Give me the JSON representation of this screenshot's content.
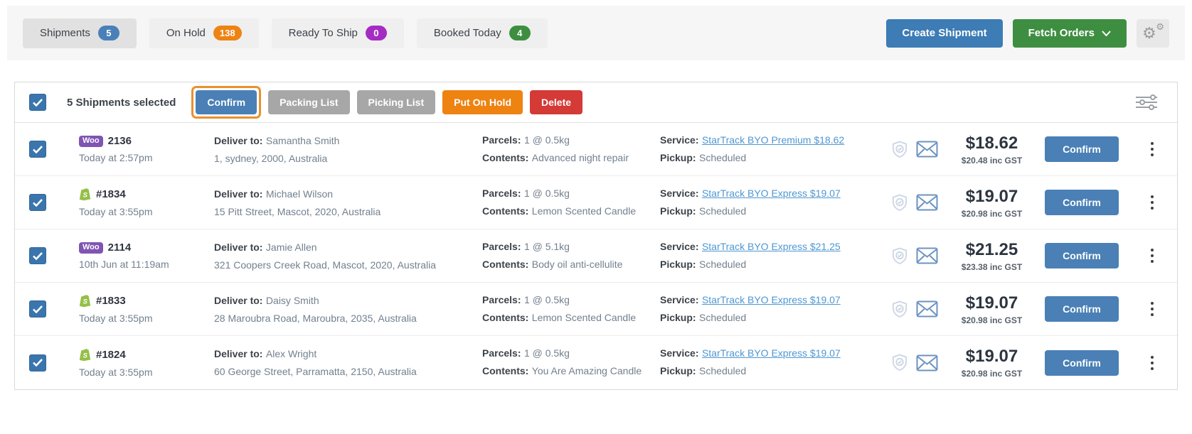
{
  "top_bar": {
    "tabs": [
      {
        "label": "Shipments",
        "count": "5",
        "badge_color": "#4a80b8",
        "active": true
      },
      {
        "label": "On Hold",
        "count": "138",
        "badge_color": "#ee8312",
        "active": false
      },
      {
        "label": "Ready To Ship",
        "count": "0",
        "badge_color": "#a42cc3",
        "active": false
      },
      {
        "label": "Booked Today",
        "count": "4",
        "badge_color": "#3e8e41",
        "active": false
      }
    ],
    "create_shipment_label": "Create Shipment",
    "fetch_orders_label": "Fetch Orders"
  },
  "bulk_bar": {
    "selected_text": "5 Shipments selected",
    "confirm_label": "Confirm",
    "packing_list_label": "Packing List",
    "picking_list_label": "Picking List",
    "put_on_hold_label": "Put On Hold",
    "delete_label": "Delete"
  },
  "labels": {
    "deliver_to": "Deliver to:",
    "parcels": "Parcels:",
    "contents": "Contents:",
    "service": "Service:",
    "pickup": "Pickup:",
    "row_confirm": "Confirm",
    "woo_badge_text": "Woo",
    "shopify_letter": "S"
  },
  "colors": {
    "primary_blue": "#3d7cb5",
    "confirm_blue": "#4a80b5",
    "green": "#3e8e41",
    "orange": "#ee8312",
    "red": "#d43a36",
    "gray_button": "#a7a7a7",
    "purple_badge": "#a42cc3",
    "link_blue": "#4e97d1",
    "highlight_orange": "#e8912d",
    "woo_purple": "#7f54b3",
    "shopify_green": "#95bf47"
  },
  "rows": [
    {
      "source": "woocommerce",
      "order_id": "2136",
      "date": "Today at 2:57pm",
      "recipient": "Samantha Smith",
      "address": "1, sydney, 2000, Australia",
      "parcels": "1 @ 0.5kg",
      "contents": "Advanced night repair",
      "service": "StarTrack BYO Premium $18.62",
      "pickup": "Scheduled",
      "price": "$18.62",
      "price_inc_gst": "$20.48 inc GST"
    },
    {
      "source": "shopify",
      "order_id": "#1834",
      "date": "Today at 3:55pm",
      "recipient": "Michael Wilson",
      "address": "15 Pitt Street, Mascot, 2020, Australia",
      "parcels": "1 @ 0.5kg",
      "contents": "Lemon Scented Candle",
      "service": "StarTrack BYO Express $19.07",
      "pickup": "Scheduled",
      "price": "$19.07",
      "price_inc_gst": "$20.98 inc GST"
    },
    {
      "source": "woocommerce",
      "order_id": "2114",
      "date": "10th Jun at 11:19am",
      "recipient": "Jamie Allen",
      "address": "321 Coopers Creek Road, Mascot, 2020, Australia",
      "parcels": "1 @ 5.1kg",
      "contents": "Body oil anti-cellulite",
      "service": "StarTrack BYO Express $21.25",
      "pickup": "Scheduled",
      "price": "$21.25",
      "price_inc_gst": "$23.38 inc GST"
    },
    {
      "source": "shopify",
      "order_id": "#1833",
      "date": "Today at 3:55pm",
      "recipient": "Daisy Smith",
      "address": "28 Maroubra Road, Maroubra, 2035, Australia",
      "parcels": "1 @ 0.5kg",
      "contents": "Lemon Scented Candle",
      "service": "StarTrack BYO Express $19.07",
      "pickup": "Scheduled",
      "price": "$19.07",
      "price_inc_gst": "$20.98 inc GST"
    },
    {
      "source": "shopify",
      "order_id": "#1824",
      "date": "Today at 3:55pm",
      "recipient": "Alex Wright",
      "address": "60 George Street, Parramatta, 2150, Australia",
      "parcels": "1 @ 0.5kg",
      "contents": "You Are Amazing Candle",
      "service": "StarTrack BYO Express $19.07",
      "pickup": "Scheduled",
      "price": "$19.07",
      "price_inc_gst": "$20.98 inc GST"
    }
  ]
}
